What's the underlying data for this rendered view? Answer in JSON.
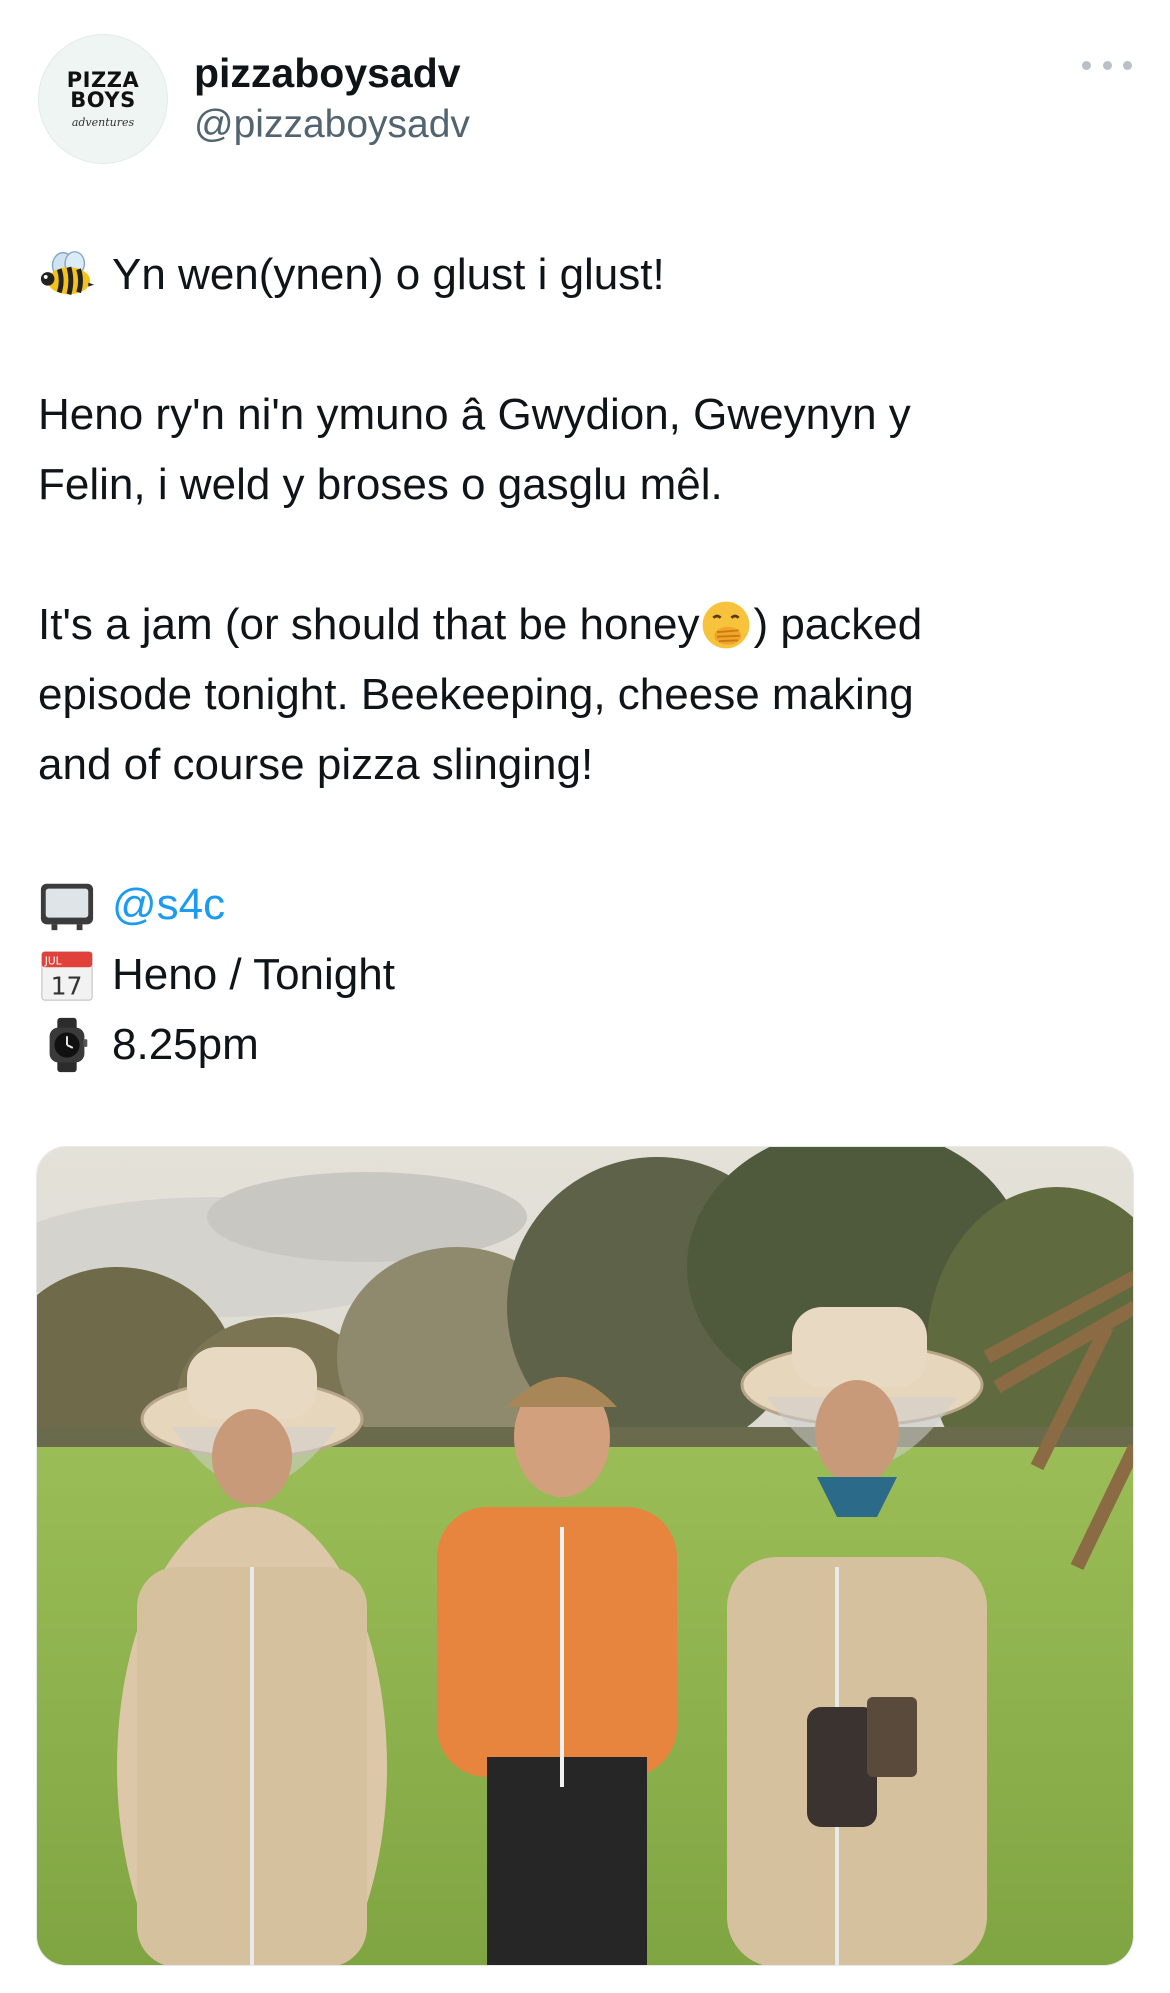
{
  "account": {
    "display_name": "pizzaboysadv",
    "handle": "@pizzaboysadv",
    "avatar_text": [
      "PIZZA",
      "BOYS",
      "adventures"
    ]
  },
  "tweet": {
    "line1": "Yn wen(ynen) o glust i glust!",
    "para2_line1": "Heno ry'n ni'n ymuno â Gwydion, Gweynyn y",
    "para2_line2": "Felin, i weld y broses o gasglu mêl.",
    "para3_line1_a": "It's a jam (or should that be honey",
    "para3_line1_b": ") packed",
    "para3_line2": "episode tonight. Beekeeping, cheese making",
    "para3_line3": "and of course pizza slinging!",
    "mention": "@s4c",
    "date_line": "Heno / Tonight",
    "time_line": "8.25pm",
    "calendar_emoji": {
      "month": "JUL",
      "day": "17"
    }
  },
  "icons": {
    "bee": "bee-icon",
    "hand_over_mouth": "face-with-hand-over-mouth-icon",
    "tv": "television-icon",
    "calendar": "calendar-icon",
    "watch": "watch-icon",
    "more": "more-icon"
  },
  "colors": {
    "text": "#0f1419",
    "secondary": "#536471",
    "link": "#1d9bf0"
  }
}
